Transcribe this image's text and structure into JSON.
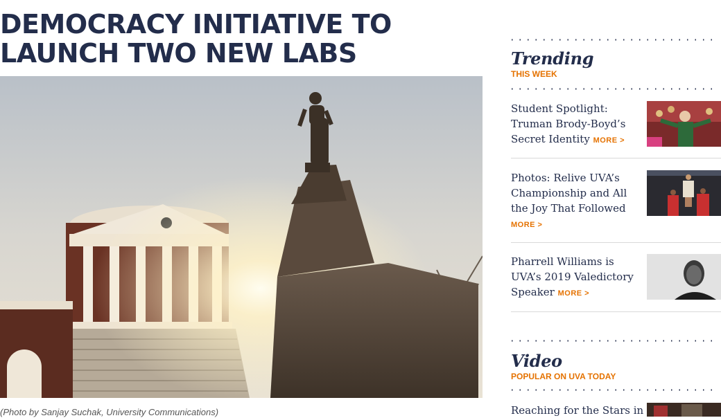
{
  "article": {
    "headline": "DEMOCRACY INITIATIVE TO LAUNCH TWO NEW LABS",
    "caption": "(Photo by Sanjay Suchak, University Communications)"
  },
  "sidebar": {
    "trending": {
      "title": "Trending",
      "subtitle": "THIS WEEK",
      "stories": [
        {
          "title": "Student Spotlight: Truman Brody-Boyd’s Secret Identity",
          "more": "MORE >"
        },
        {
          "title": "Photos: Relive UVA’s Championship and All the Joy That Followed",
          "more": "MORE >"
        },
        {
          "title": "Pharrell Williams is UVA’s 2019 Valedictory Speaker",
          "more": "MORE >"
        }
      ]
    },
    "video": {
      "title": "Video",
      "subtitle": "POPULAR ON UVA TODAY",
      "stories": [
        {
          "title": "Reaching for the Stars in"
        }
      ]
    }
  },
  "colors": {
    "navy": "#232d4b",
    "orange": "#e57200"
  }
}
